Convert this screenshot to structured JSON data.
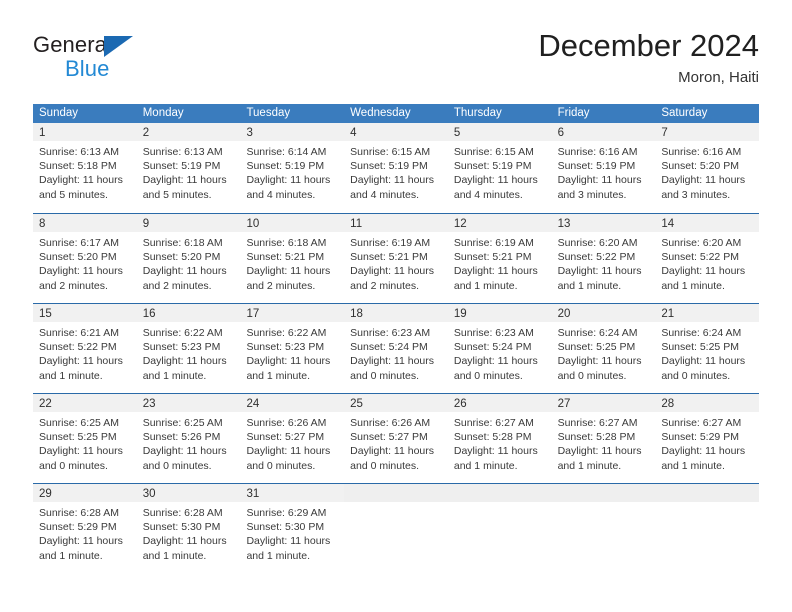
{
  "brand": {
    "name_part1": "General",
    "name_part2": "Blue",
    "triangle_icon": "triangle-logo-icon"
  },
  "header": {
    "title": "December 2024",
    "location": "Moron, Haiti"
  },
  "colors": {
    "header_blue": "#3a7cbe",
    "divider_blue": "#2a6aa8",
    "daynum_band": "#f1f1f1",
    "brand_blue": "#2389d4",
    "brand_dark": "#231f20"
  },
  "weekdays": [
    "Sunday",
    "Monday",
    "Tuesday",
    "Wednesday",
    "Thursday",
    "Friday",
    "Saturday"
  ],
  "weeks": [
    [
      {
        "day": "1",
        "lines": [
          "Sunrise: 6:13 AM",
          "Sunset: 5:18 PM",
          "Daylight: 11 hours",
          "and 5 minutes."
        ]
      },
      {
        "day": "2",
        "lines": [
          "Sunrise: 6:13 AM",
          "Sunset: 5:19 PM",
          "Daylight: 11 hours",
          "and 5 minutes."
        ]
      },
      {
        "day": "3",
        "lines": [
          "Sunrise: 6:14 AM",
          "Sunset: 5:19 PM",
          "Daylight: 11 hours",
          "and 4 minutes."
        ]
      },
      {
        "day": "4",
        "lines": [
          "Sunrise: 6:15 AM",
          "Sunset: 5:19 PM",
          "Daylight: 11 hours",
          "and 4 minutes."
        ]
      },
      {
        "day": "5",
        "lines": [
          "Sunrise: 6:15 AM",
          "Sunset: 5:19 PM",
          "Daylight: 11 hours",
          "and 4 minutes."
        ]
      },
      {
        "day": "6",
        "lines": [
          "Sunrise: 6:16 AM",
          "Sunset: 5:19 PM",
          "Daylight: 11 hours",
          "and 3 minutes."
        ]
      },
      {
        "day": "7",
        "lines": [
          "Sunrise: 6:16 AM",
          "Sunset: 5:20 PM",
          "Daylight: 11 hours",
          "and 3 minutes."
        ]
      }
    ],
    [
      {
        "day": "8",
        "lines": [
          "Sunrise: 6:17 AM",
          "Sunset: 5:20 PM",
          "Daylight: 11 hours",
          "and 2 minutes."
        ]
      },
      {
        "day": "9",
        "lines": [
          "Sunrise: 6:18 AM",
          "Sunset: 5:20 PM",
          "Daylight: 11 hours",
          "and 2 minutes."
        ]
      },
      {
        "day": "10",
        "lines": [
          "Sunrise: 6:18 AM",
          "Sunset: 5:21 PM",
          "Daylight: 11 hours",
          "and 2 minutes."
        ]
      },
      {
        "day": "11",
        "lines": [
          "Sunrise: 6:19 AM",
          "Sunset: 5:21 PM",
          "Daylight: 11 hours",
          "and 2 minutes."
        ]
      },
      {
        "day": "12",
        "lines": [
          "Sunrise: 6:19 AM",
          "Sunset: 5:21 PM",
          "Daylight: 11 hours",
          "and 1 minute."
        ]
      },
      {
        "day": "13",
        "lines": [
          "Sunrise: 6:20 AM",
          "Sunset: 5:22 PM",
          "Daylight: 11 hours",
          "and 1 minute."
        ]
      },
      {
        "day": "14",
        "lines": [
          "Sunrise: 6:20 AM",
          "Sunset: 5:22 PM",
          "Daylight: 11 hours",
          "and 1 minute."
        ]
      }
    ],
    [
      {
        "day": "15",
        "lines": [
          "Sunrise: 6:21 AM",
          "Sunset: 5:22 PM",
          "Daylight: 11 hours",
          "and 1 minute."
        ]
      },
      {
        "day": "16",
        "lines": [
          "Sunrise: 6:22 AM",
          "Sunset: 5:23 PM",
          "Daylight: 11 hours",
          "and 1 minute."
        ]
      },
      {
        "day": "17",
        "lines": [
          "Sunrise: 6:22 AM",
          "Sunset: 5:23 PM",
          "Daylight: 11 hours",
          "and 1 minute."
        ]
      },
      {
        "day": "18",
        "lines": [
          "Sunrise: 6:23 AM",
          "Sunset: 5:24 PM",
          "Daylight: 11 hours",
          "and 0 minutes."
        ]
      },
      {
        "day": "19",
        "lines": [
          "Sunrise: 6:23 AM",
          "Sunset: 5:24 PM",
          "Daylight: 11 hours",
          "and 0 minutes."
        ]
      },
      {
        "day": "20",
        "lines": [
          "Sunrise: 6:24 AM",
          "Sunset: 5:25 PM",
          "Daylight: 11 hours",
          "and 0 minutes."
        ]
      },
      {
        "day": "21",
        "lines": [
          "Sunrise: 6:24 AM",
          "Sunset: 5:25 PM",
          "Daylight: 11 hours",
          "and 0 minutes."
        ]
      }
    ],
    [
      {
        "day": "22",
        "lines": [
          "Sunrise: 6:25 AM",
          "Sunset: 5:25 PM",
          "Daylight: 11 hours",
          "and 0 minutes."
        ]
      },
      {
        "day": "23",
        "lines": [
          "Sunrise: 6:25 AM",
          "Sunset: 5:26 PM",
          "Daylight: 11 hours",
          "and 0 minutes."
        ]
      },
      {
        "day": "24",
        "lines": [
          "Sunrise: 6:26 AM",
          "Sunset: 5:27 PM",
          "Daylight: 11 hours",
          "and 0 minutes."
        ]
      },
      {
        "day": "25",
        "lines": [
          "Sunrise: 6:26 AM",
          "Sunset: 5:27 PM",
          "Daylight: 11 hours",
          "and 0 minutes."
        ]
      },
      {
        "day": "26",
        "lines": [
          "Sunrise: 6:27 AM",
          "Sunset: 5:28 PM",
          "Daylight: 11 hours",
          "and 1 minute."
        ]
      },
      {
        "day": "27",
        "lines": [
          "Sunrise: 6:27 AM",
          "Sunset: 5:28 PM",
          "Daylight: 11 hours",
          "and 1 minute."
        ]
      },
      {
        "day": "28",
        "lines": [
          "Sunrise: 6:27 AM",
          "Sunset: 5:29 PM",
          "Daylight: 11 hours",
          "and 1 minute."
        ]
      }
    ],
    [
      {
        "day": "29",
        "lines": [
          "Sunrise: 6:28 AM",
          "Sunset: 5:29 PM",
          "Daylight: 11 hours",
          "and 1 minute."
        ]
      },
      {
        "day": "30",
        "lines": [
          "Sunrise: 6:28 AM",
          "Sunset: 5:30 PM",
          "Daylight: 11 hours",
          "and 1 minute."
        ]
      },
      {
        "day": "31",
        "lines": [
          "Sunrise: 6:29 AM",
          "Sunset: 5:30 PM",
          "Daylight: 11 hours",
          "and 1 minute."
        ]
      },
      {
        "day": "",
        "lines": []
      },
      {
        "day": "",
        "lines": []
      },
      {
        "day": "",
        "lines": []
      },
      {
        "day": "",
        "lines": []
      }
    ]
  ]
}
